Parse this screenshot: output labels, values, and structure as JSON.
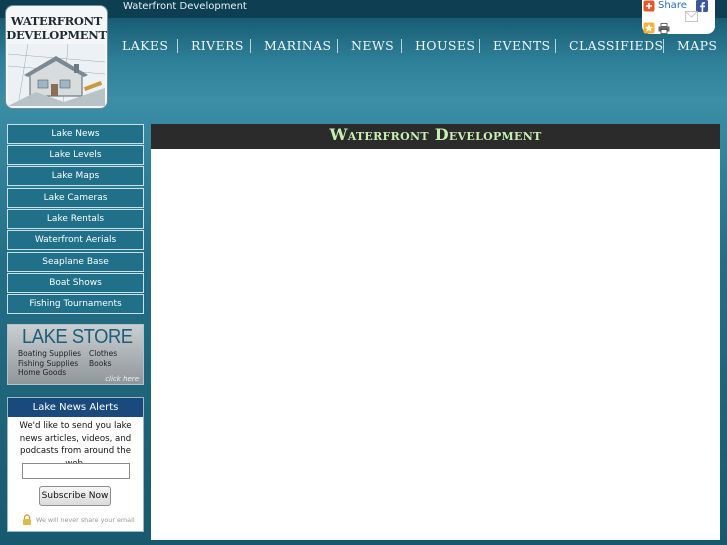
{
  "header": {
    "site_name": "Waterfront Development",
    "logo_line1": "WATERFRONT",
    "logo_line2": "DEVELOPMENT"
  },
  "nav": {
    "items": [
      "LAKES",
      "RIVERS",
      "MARINAS",
      "NEWS",
      "HOUSES",
      "EVENTS",
      "CLASSIFIEDS",
      "MAPS"
    ]
  },
  "share": {
    "label": "Share",
    "icons": [
      "share-plus-icon",
      "facebook-icon",
      "favorite-star-icon",
      "print-icon",
      "email-icon"
    ]
  },
  "sidebar": {
    "items": [
      "Lake News",
      "Lake Levels",
      "Lake Maps",
      "Lake Cameras",
      "Lake Rentals",
      "Waterfront Aerials",
      "Seaplane Base",
      "Boat Shows",
      "Fishing Tournaments"
    ]
  },
  "lake_store": {
    "title": "LAKE STORE",
    "items": [
      "Boating Supplies",
      "Clothes",
      "Fishing Supplies",
      "Books",
      "Home Goods"
    ],
    "click_here": "click here"
  },
  "alerts": {
    "title": "Lake News Alerts",
    "text": "We'd like to send you lake news articles, videos, and podcasts from around the web.",
    "input_value": "",
    "button": "Subscribe Now",
    "privacy": "We will never share your email"
  },
  "main": {
    "title": "Waterfront Development"
  },
  "colors": {
    "accent_header": "#2b2b2b",
    "title_green": "#c6efb2",
    "nav_button": "#1f7088",
    "alerts_head": "#1a4a7d"
  }
}
